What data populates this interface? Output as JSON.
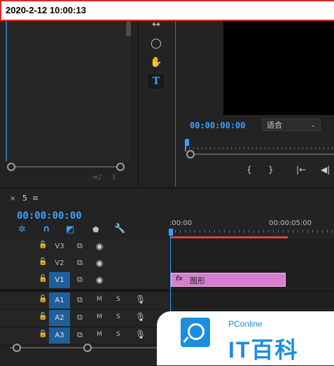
{
  "overlay": {
    "datetime": "2020-2-12 10:00:13"
  },
  "colors": {
    "accent": "#3aa0ff",
    "clip": "#d67fd0",
    "work_area": "#e04040",
    "highlight_border": "#e0282b",
    "brand": "#1a8ee0"
  },
  "tools": [
    {
      "icon": "ripple-edit-icon",
      "glyph": "↔"
    },
    {
      "icon": "pen-ellipse-icon",
      "glyph": "◯"
    },
    {
      "icon": "hand-icon",
      "glyph": "✋"
    },
    {
      "icon": "type-tool-icon",
      "glyph": "T"
    }
  ],
  "program": {
    "timecode": "00:00:00:00",
    "fit_option": "适合",
    "controls": [
      "{",
      "}",
      "|←",
      "◀|"
    ]
  },
  "timeline": {
    "close": "×",
    "sequence_name": "5",
    "menu": "≡",
    "timecode": "00:00:00:00",
    "ruler_start": ":00:00",
    "ruler_mid": "00:00:05:00",
    "video_tracks": [
      {
        "name": "V3",
        "targeted": false
      },
      {
        "name": "V2",
        "targeted": false
      },
      {
        "name": "V1",
        "targeted": true
      }
    ],
    "audio_tracks": [
      {
        "name": "A1",
        "targeted": true,
        "mute": "M",
        "solo": "S"
      },
      {
        "name": "A2",
        "targeted": true,
        "mute": "M",
        "solo": "S"
      },
      {
        "name": "A3",
        "targeted": true,
        "mute": "M",
        "solo": "S"
      }
    ],
    "clip": {
      "fx": "fx",
      "name": "图形"
    }
  },
  "watermark": {
    "site": "PConline",
    "brand": "IT百科"
  }
}
